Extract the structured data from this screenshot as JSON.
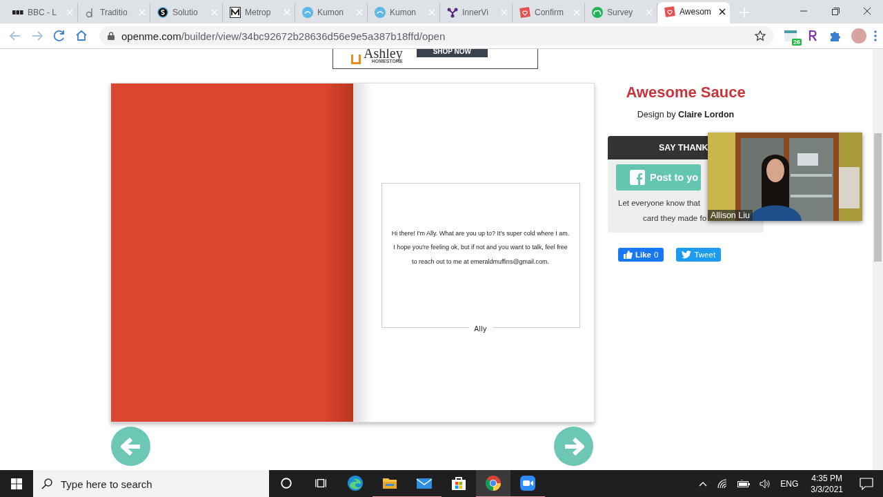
{
  "browser": {
    "tabs": [
      {
        "title": "BBC - L",
        "kind": "bbc",
        "selected": false
      },
      {
        "title": "Traditio",
        "kind": "letter",
        "selected": false
      },
      {
        "title": "Solutio",
        "kind": "s",
        "selected": false
      },
      {
        "title": "Metrop",
        "kind": "m",
        "selected": false
      },
      {
        "title": "Kumon",
        "kind": "kumon",
        "selected": false
      },
      {
        "title": "Kumon",
        "kind": "kumon",
        "selected": false
      },
      {
        "title": "InnerVi",
        "kind": "nodes",
        "selected": false
      },
      {
        "title": "Confirm",
        "kind": "card",
        "selected": false
      },
      {
        "title": "Survey",
        "kind": "cloud",
        "selected": false
      },
      {
        "title": "Awesom",
        "kind": "card",
        "selected": true
      }
    ],
    "url_host": "openme.com",
    "url_path": "/builder/view/34bc92672b28636d56e9e5a387b18ffd/open",
    "extension_badge": "26"
  },
  "ad": {
    "brand": "Ashley",
    "sub": "HOMESTORE",
    "cta": "SHOP NOW"
  },
  "card": {
    "message": "Hi there! I'm Ally. What are you up to? It's super cold where I am. I hope you're feeling ok, but if not and you want to talk, feel free to reach out to me at emeraldmuffins@gmail.com.",
    "signature": "Ally"
  },
  "sidebar": {
    "title": "Awesome Sauce",
    "byline": "Design by **Claire Lordon**",
    "panel_header": "SAY THANK",
    "post_button": "Post to yo",
    "note_lines": [
      "Let everyone know that",
      "card they made fo"
    ],
    "like": "Like",
    "like_count": "0",
    "tweet": "Tweet"
  },
  "video": {
    "name": "Allison Liu"
  },
  "taskbar": {
    "search_placeholder": "Type here to search",
    "apps": [
      {
        "kind": "cortana",
        "running": false,
        "selected": false
      },
      {
        "kind": "taskview",
        "running": false,
        "selected": false
      },
      {
        "kind": "edge",
        "running": false,
        "selected": false
      },
      {
        "kind": "explorer",
        "running": true,
        "selected": false
      },
      {
        "kind": "mail",
        "running": true,
        "selected": false
      },
      {
        "kind": "store",
        "running": false,
        "selected": false
      },
      {
        "kind": "chrome",
        "running": true,
        "selected": true
      },
      {
        "kind": "zoom",
        "running": true,
        "selected": false
      }
    ],
    "language": "ENG",
    "time": "4:35 PM",
    "date": "3/3/2021"
  }
}
